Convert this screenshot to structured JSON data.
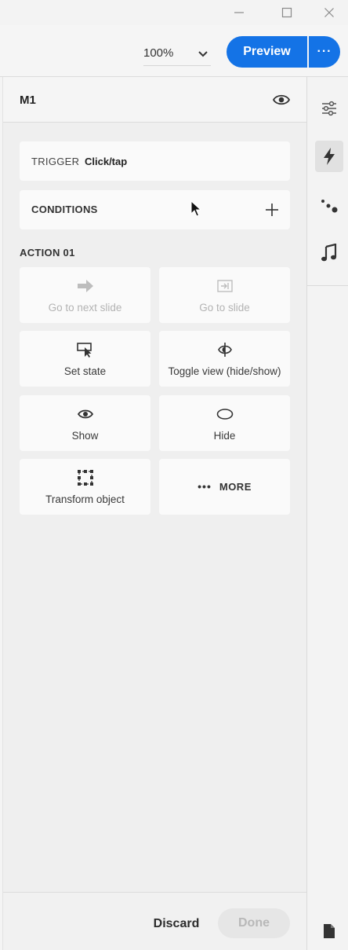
{
  "toolbar": {
    "zoom_value": "100%",
    "preview_label": "Preview",
    "more_label": "···"
  },
  "panel": {
    "title": "M1",
    "trigger": {
      "label": "TRIGGER",
      "value": "Click/tap"
    },
    "conditions_label": "CONDITIONS",
    "action_heading": "ACTION 01",
    "actions": [
      {
        "label": "Go to next slide",
        "icon": "arrow-right-icon",
        "enabled": false
      },
      {
        "label": "Go to slide",
        "icon": "go-to-slide-icon",
        "enabled": false
      },
      {
        "label": "Set state",
        "icon": "set-state-icon",
        "enabled": true
      },
      {
        "label": "Toggle view (hide/show)",
        "icon": "toggle-view-icon",
        "enabled": true
      },
      {
        "label": "Show",
        "icon": "eye-icon",
        "enabled": true
      },
      {
        "label": "Hide",
        "icon": "hide-icon",
        "enabled": true
      },
      {
        "label": "Transform object",
        "icon": "transform-icon",
        "enabled": true
      }
    ],
    "more_dots": "•••",
    "more_label": "MORE"
  },
  "footer": {
    "discard_label": "Discard",
    "done_label": "Done"
  },
  "rail": {
    "items": [
      "properties-icon",
      "actions-icon",
      "motion-icon",
      "audio-icon",
      "page-icon"
    ],
    "active": "actions-icon"
  },
  "colors": {
    "accent": "#1473e6",
    "panel_bg": "#efefef",
    "card_bg": "#fafafa",
    "disabled_text": "#b3b3b3"
  }
}
